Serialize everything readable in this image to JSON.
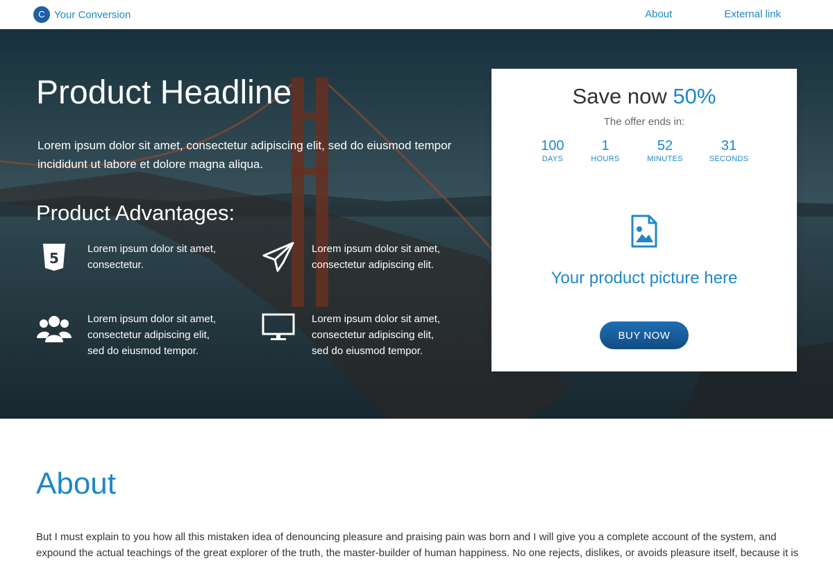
{
  "navbar": {
    "brand_letter": "C",
    "brand_name": "Your Conversion",
    "links": [
      "About",
      "External link"
    ]
  },
  "hero": {
    "headline": "Product Headline",
    "subheadline": "Lorem ipsum dolor sit amet, consectetur adipiscing elit, sed do eiusmod tempor incididunt ut labore et dolore magna aliqua.",
    "advantages_title": "Product Advantages:",
    "advantages": [
      {
        "icon": "html5-icon",
        "text": "Lorem ipsum dolor sit amet, consectetur."
      },
      {
        "icon": "paper-plane-icon",
        "text": "Lorem ipsum dolor sit amet, consectetur adipiscing elit."
      },
      {
        "icon": "users-icon",
        "text": "Lorem ipsum dolor sit amet, consectetur adipiscing elit, sed do eiusmod tempor."
      },
      {
        "icon": "monitor-icon",
        "text": "Lorem ipsum dolor sit amet, consectetur adipiscing elit, sed do eiusmod tempor."
      }
    ]
  },
  "offer": {
    "save_label": "Save now",
    "save_percent": "50%",
    "ends_label": "The offer ends in:",
    "countdown": [
      {
        "value": "100",
        "label": "DAYS"
      },
      {
        "value": "1",
        "label": "HOURS"
      },
      {
        "value": "52",
        "label": "MINUTES"
      },
      {
        "value": "31",
        "label": "SECONDS"
      }
    ],
    "picture_icon": "image-file-icon",
    "picture_text": "Your product picture here",
    "buy_label": "BUY NOW"
  },
  "about": {
    "title": "About",
    "text": "But I must explain to you how all this mistaken idea of denouncing pleasure and praising pain was born and I will give you a complete account of the system, and expound the actual teachings of the great explorer of the truth, the master-builder of human happiness. No one rejects, dislikes, or avoids pleasure itself, because it is"
  },
  "colors": {
    "accent": "#1e88c6",
    "button": "#124b82",
    "brand_badge": "#1f5fa5"
  }
}
